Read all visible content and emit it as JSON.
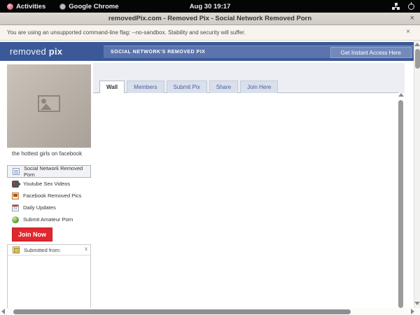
{
  "system_bar": {
    "activities": "Activities",
    "app_name": "Google Chrome",
    "clock": "Aug 30 19:17"
  },
  "window": {
    "title": "removedPix.com - Removed Pix - Social Network Removed Porn",
    "close": "×"
  },
  "infobar": {
    "message": "You are using an unsupported command-line flag: --no-sandbox. Stability and security will suffer.",
    "close": "×"
  },
  "site_header": {
    "logo_word1": "removed",
    "logo_word2": "pix",
    "banner": "SOCIAL NETWORK'S REMOVED PIX",
    "access_button": "Get Instant Access Here"
  },
  "tabs": [
    {
      "label": "Wall",
      "active": true
    },
    {
      "label": "Members",
      "active": false
    },
    {
      "label": "Submit Pix",
      "active": false
    },
    {
      "label": "Share",
      "active": false
    },
    {
      "label": "Join Here",
      "active": false
    }
  ],
  "sidebar": {
    "photo_caption": "the hottest girls on facebook",
    "menu": [
      {
        "label": "Social Network Removed Porn",
        "icon": "note-icon",
        "selected": true
      },
      {
        "label": "Youtube Sex Videos",
        "icon": "video-icon",
        "selected": false
      },
      {
        "label": "Facebook Removed Pics",
        "icon": "photo-icon",
        "selected": false
      },
      {
        "label": "Daily Updates",
        "icon": "calendar-icon",
        "selected": false
      },
      {
        "label": "Submit Amateur Porn",
        "icon": "globe-icon",
        "selected": false
      }
    ],
    "join_button": "Join Now",
    "submitted_box": {
      "title": "Submitted from:",
      "close": "x"
    }
  },
  "colors": {
    "header_blue": "#3b5998",
    "strip_blue": "#5b74ae",
    "access_button_blue": "#7289bb",
    "tab_inactive_bg": "#d9dfeb",
    "join_red": "#e2282d"
  }
}
